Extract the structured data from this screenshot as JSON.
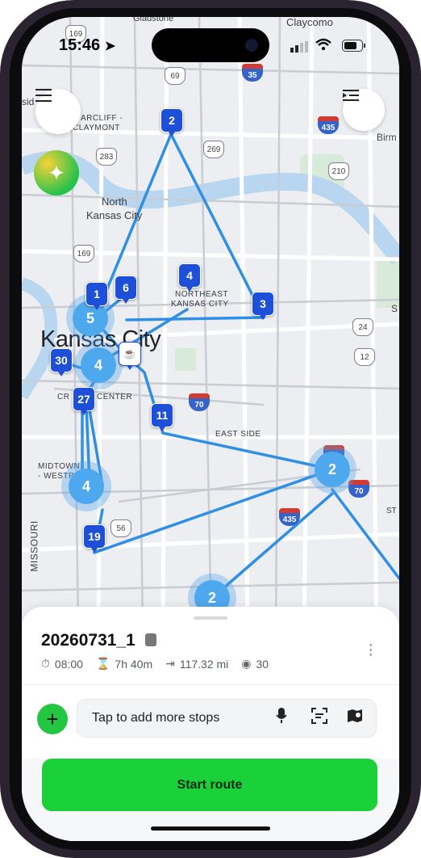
{
  "status_bar": {
    "time": "15:46"
  },
  "map": {
    "city": "Kansas City",
    "labels": [
      {
        "id": "gladstone",
        "text": "Gladstone"
      },
      {
        "id": "claycomo",
        "text": "Claycomo"
      },
      {
        "id": "briarcliff",
        "text": "ARCLIFF -"
      },
      {
        "id": "claymont",
        "text": "CLAYMONT"
      },
      {
        "id": "north_kc",
        "text": "North"
      },
      {
        "id": "north_kc2",
        "text": "Kansas City"
      },
      {
        "id": "birm",
        "text": "Birm"
      },
      {
        "id": "ne_kc",
        "text": "NORTHEAST"
      },
      {
        "id": "ne_kc2",
        "text": "KANSAS CITY"
      },
      {
        "id": "crossroads",
        "text": "CR"
      },
      {
        "id": "center",
        "text": "CENTER"
      },
      {
        "id": "east_side",
        "text": "EAST SIDE"
      },
      {
        "id": "midtown",
        "text": "MIDTOWN"
      },
      {
        "id": "westport",
        "text": "- WESTP"
      },
      {
        "id": "missouri",
        "text": "MISSOURI"
      },
      {
        "id": "sid",
        "text": "sid"
      },
      {
        "id": "st",
        "text": "ST"
      },
      {
        "id": "s_edge",
        "text": "S"
      }
    ],
    "shields": [
      {
        "id": "r169a",
        "text": "169",
        "kind": "us"
      },
      {
        "id": "r69",
        "text": "69",
        "kind": "us"
      },
      {
        "id": "r35a",
        "text": "35",
        "kind": "interstate"
      },
      {
        "id": "r435a",
        "text": "435",
        "kind": "interstate"
      },
      {
        "id": "r283",
        "text": "283",
        "kind": "us"
      },
      {
        "id": "r269",
        "text": "269",
        "kind": "us"
      },
      {
        "id": "r210",
        "text": "210",
        "kind": "us"
      },
      {
        "id": "r169b",
        "text": "169",
        "kind": "us"
      },
      {
        "id": "r24",
        "text": "24",
        "kind": "us"
      },
      {
        "id": "r12",
        "text": "12",
        "kind": "us"
      },
      {
        "id": "r70a",
        "text": "70",
        "kind": "interstate"
      },
      {
        "id": "r435b",
        "text": "435",
        "kind": "interstate"
      },
      {
        "id": "r70b",
        "text": "70",
        "kind": "interstate"
      },
      {
        "id": "r56",
        "text": "56",
        "kind": "us"
      },
      {
        "id": "r40",
        "text": "40",
        "kind": "interstate"
      }
    ],
    "pins": [
      {
        "id": "p2",
        "text": "2"
      },
      {
        "id": "p1",
        "text": "1"
      },
      {
        "id": "p6",
        "text": "6"
      },
      {
        "id": "p4",
        "text": "4"
      },
      {
        "id": "p3",
        "text": "3"
      },
      {
        "id": "p30",
        "text": "30"
      },
      {
        "id": "p27",
        "text": "27"
      },
      {
        "id": "p11",
        "text": "11"
      },
      {
        "id": "p19",
        "text": "19"
      }
    ],
    "clusters": [
      {
        "id": "c5",
        "text": "5"
      },
      {
        "id": "c4a",
        "text": "4"
      },
      {
        "id": "c4b",
        "text": "4"
      },
      {
        "id": "c2a",
        "text": "2"
      },
      {
        "id": "c2b",
        "text": "2"
      }
    ],
    "route_color": "#2f8fe6",
    "pin_color": "#1d4fd8",
    "cluster_color": "#4ea8ee"
  },
  "buttons": {
    "menu_icon": "hamburger-icon",
    "route_list_icon": "route-list-icon",
    "ai_icon": "sparkles-icon"
  },
  "sheet": {
    "route_name": "20260731_1",
    "start_time": "08:00",
    "duration": "7h 40m",
    "distance": "117.32 mi",
    "stops": "30",
    "add_stops_placeholder": "Tap to add more stops",
    "start_label": "Start route"
  },
  "colors": {
    "accent_green": "#1bd13a",
    "plus_green": "#23c640"
  }
}
